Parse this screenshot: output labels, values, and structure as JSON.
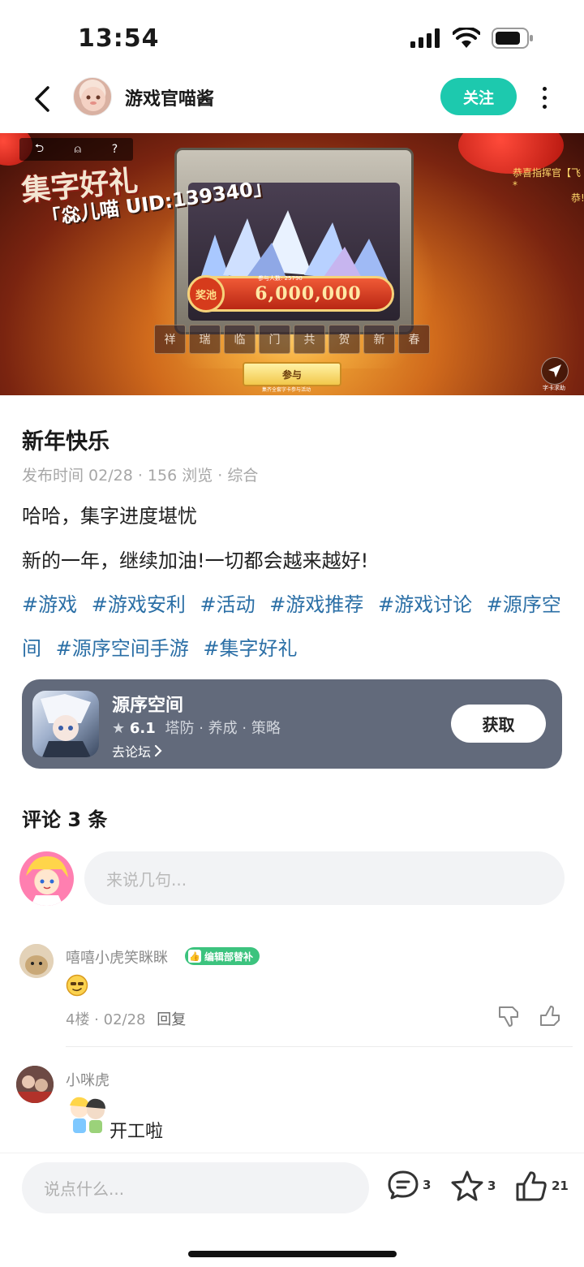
{
  "status_bar": {
    "time": "13:54"
  },
  "nav": {
    "author": "游戏官喵酱",
    "follow_label": "关注"
  },
  "banner": {
    "title": "集字好礼",
    "uid": "「惢儿喵 UID:139340」",
    "top_icons": [
      "⮌",
      "⍝",
      "?"
    ],
    "pool_tag": "奖池",
    "pool_value": "6,000,000",
    "participants": "参与人数: 25790",
    "chars": [
      "祥",
      "瑞",
      "临",
      "门",
      "共",
      "贺",
      "新",
      "春"
    ],
    "join_label": "参与",
    "join_hint": "集齐全套字卡参与活动",
    "share_label": "字卡求助",
    "side_text": "恭喜指挥官【飞*",
    "side_text2": "恭!"
  },
  "post": {
    "title": "新年快乐",
    "meta": "发布时间 02/28 · 156 浏览 · 综合",
    "lines": [
      "哈哈，集字进度堪忧",
      "新的一年，继续加油!一切都会越来越好!"
    ],
    "tags": [
      "#游戏",
      "#游戏安利",
      "#活动",
      "#游戏推荐",
      "#游戏讨论",
      "#源序空间",
      "#源序空间手游",
      "#集字好礼"
    ]
  },
  "game_card": {
    "name": "源序空间",
    "rating": "6.1",
    "genres": "塔防 · 养成 · 策略",
    "forum_link": "去论坛",
    "get_label": "获取"
  },
  "comments": {
    "title": "评论 3 条",
    "input_placeholder": "来说几句...",
    "items": [
      {
        "user": "嘻嘻小虎笑眯眯",
        "badge": "编辑部替补",
        "meta": "4楼 · 02/28",
        "reply": "回复"
      },
      {
        "user": "小咪虎",
        "text": "开工啦"
      }
    ]
  },
  "bottom": {
    "input_placeholder": "说点什么...",
    "comment_count": "3",
    "star_count": "3",
    "like_count": "21"
  },
  "colors": {
    "accent": "#1dc9ae",
    "tag": "#2b6fa6",
    "badge": "#3cc37e",
    "card": "#626a7b"
  }
}
